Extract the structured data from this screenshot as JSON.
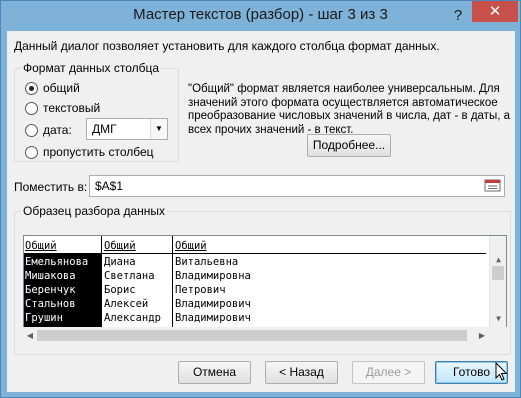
{
  "window": {
    "title": "Мастер текстов (разбор) - шаг 3 из 3",
    "help_label": "?",
    "close_label": "✕"
  },
  "intro": "Данный диалог позволяет установить для каждого столбца формат данных.",
  "format_group": {
    "legend": "Формат данных столбца",
    "options": [
      {
        "label": "общий",
        "checked": true
      },
      {
        "label": "текстовый",
        "checked": false
      },
      {
        "label": "дата:",
        "checked": false
      },
      {
        "label": "пропустить столбец",
        "checked": false
      }
    ],
    "date_combo_value": "ДМГ"
  },
  "description": "\"Общий\" формат является наиболее универсальным. Для значений этого формата осуществляется автоматическое преобразование числовых значений в числа, дат - в даты, а всех прочих значений - в текст.",
  "more_button": "Подробнее...",
  "destination": {
    "label": "Поместить в:",
    "value": "$A$1"
  },
  "preview": {
    "legend": "Образец разбора данных",
    "headers": [
      "Общий",
      "Общий",
      "Общий"
    ],
    "rows": [
      [
        "Емельянова",
        "Диана",
        "Витальевна"
      ],
      [
        "Мишакова",
        "Светлана",
        "Владимировна"
      ],
      [
        "Беренчук",
        "Борис",
        "Петрович"
      ],
      [
        "Стальнов",
        "Алексей",
        "Владимирович"
      ],
      [
        "Грушин",
        "Александр",
        "Владимирович"
      ]
    ]
  },
  "buttons": {
    "cancel": "Отмена",
    "back": "< Назад",
    "next": "Далее >",
    "finish": "Готово"
  }
}
